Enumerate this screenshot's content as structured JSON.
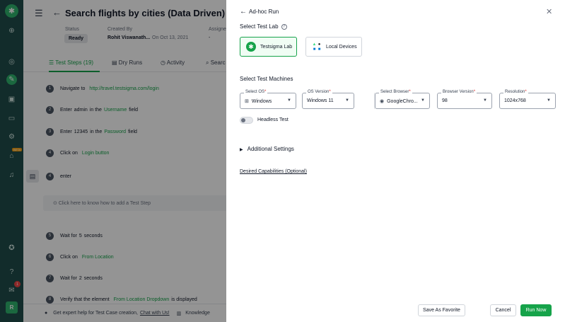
{
  "rail": {
    "logo_icon": "testsigma-logo-icon",
    "beta": "BETA",
    "notification_count": "1",
    "avatar_initial": "R"
  },
  "main": {
    "page_title": "Search flights by cities (Data Driven)",
    "status_label": "Status",
    "status_value": "Ready",
    "created_by_label": "Created By",
    "created_by_name": "Rohit Viswanath...",
    "created_on": "On Oct 13, 2021",
    "assignee_label": "Assigne",
    "assignee_value": "-",
    "tabs": [
      {
        "label": "Test Steps (19)"
      },
      {
        "label": "Dry Runs"
      },
      {
        "label": "Activity"
      },
      {
        "label": "Searc"
      }
    ],
    "steps": [
      {
        "num": "1",
        "a": "Navigate to",
        "b": "http://travel.testsigma.com/login",
        "c": "",
        "d": "",
        "e": ""
      },
      {
        "num": "2",
        "a": "Enter",
        "b": "admin",
        "c": "in the",
        "d": "Username",
        "e": "field"
      },
      {
        "num": "3",
        "a": "Enter",
        "b": "12345",
        "c": "in the",
        "d": "Password",
        "e": "field"
      },
      {
        "num": "4",
        "a": "Click on",
        "b": "Login button",
        "c": "",
        "d": "",
        "e": ""
      },
      {
        "num": "4",
        "a": "enter",
        "b": "",
        "c": "",
        "d": "",
        "e": ""
      },
      {
        "num": "5",
        "a": "Wait for",
        "b": "5",
        "c": "seconds",
        "d": "",
        "e": ""
      },
      {
        "num": "6",
        "a": "Click on",
        "b": "From Location",
        "c": "",
        "d": "",
        "e": ""
      },
      {
        "num": "7",
        "a": "Wait for",
        "b": "2",
        "c": "seconds",
        "d": "",
        "e": ""
      },
      {
        "num": "8",
        "a": "Verify that the element",
        "b": "From Location Dropdown",
        "c": "is displayed",
        "d": "",
        "e": ""
      }
    ],
    "hint": "Click here to know how to add a Test Step",
    "footer_text": "Get expert help for Test Case creation,",
    "footer_link": "Chat with Us!",
    "footer_knowledge": "Knowledge"
  },
  "drawer": {
    "title": "Ad-hoc Run",
    "select_lab": "Select Test Lab",
    "labs": [
      {
        "label": "Testsigma Lab",
        "selected": true
      },
      {
        "label": "Local Devices",
        "selected": false
      }
    ],
    "select_machines": "Select Test Machines",
    "fields": {
      "os": {
        "label": "Select OS",
        "value": "Windows"
      },
      "os_version": {
        "label": "OS Version",
        "value": "Windows 11"
      },
      "browser": {
        "label": "Select Browser",
        "value": "GoogleChro..."
      },
      "browser_version": {
        "label": "Browser Version",
        "value": "98"
      },
      "resolution": {
        "label": "Resolution",
        "value": "1024x768"
      }
    },
    "headless": "Headless Test",
    "additional": "Additional Settings",
    "desired": "Desired Capabilities (Optional)",
    "buttons": {
      "favorite": "Save As Favorite",
      "cancel": "Cancel",
      "run": "Run Now"
    }
  },
  "colors": {
    "rail": "#1f4d4a",
    "accent": "#16a34a"
  }
}
